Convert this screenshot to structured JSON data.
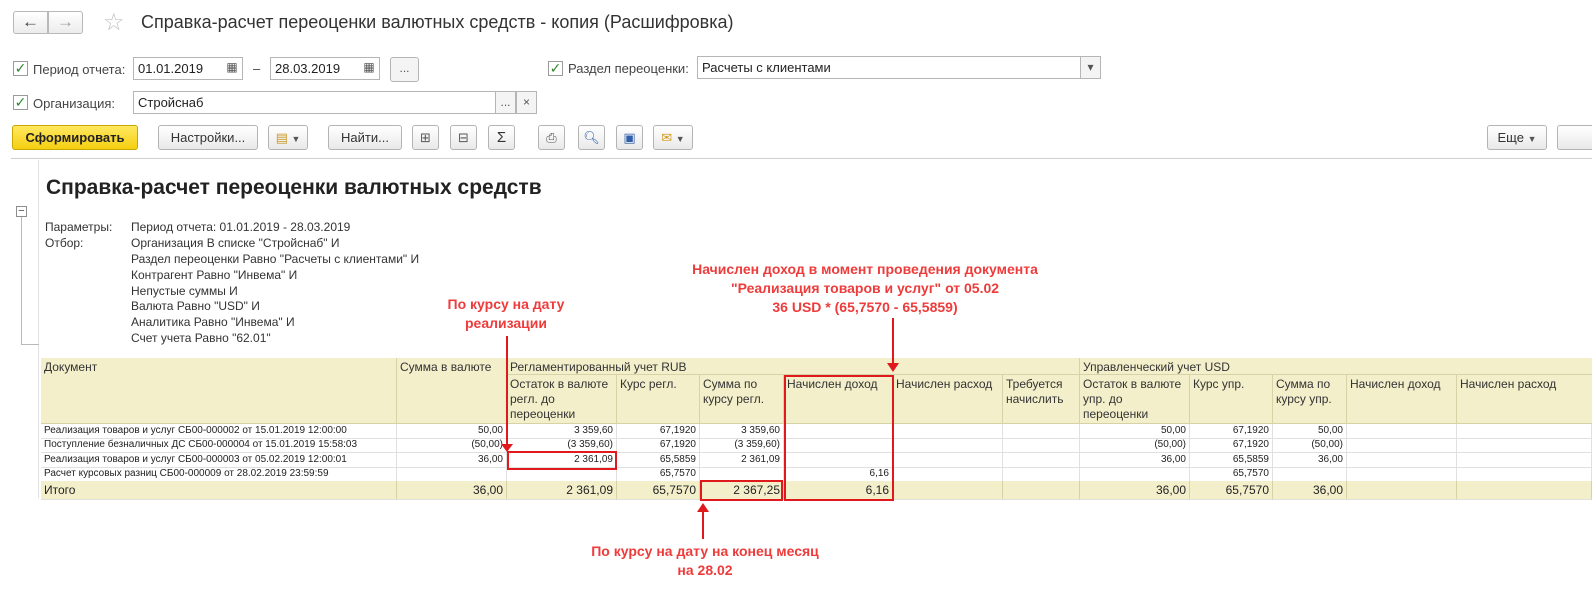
{
  "window": {
    "title": "Справка-расчет переоценки валютных средств - копия (Расшифровка)",
    "back_icon": "←",
    "forward_icon": "→"
  },
  "filters": {
    "period_label": "Период отчета:",
    "date_from": "01.01.2019",
    "date_dash": "–",
    "date_to": "28.03.2019",
    "period_more": "...",
    "section_label": "Раздел переоценки:",
    "section_value": "Расчеты с клиентами",
    "org_label": "Организация:",
    "org_value": "Стройснаб",
    "org_more": "...",
    "org_clear": "×"
  },
  "toolbar": {
    "generate": "Сформировать",
    "settings": "Настройки...",
    "find": "Найти...",
    "sum_icon": "Σ",
    "more": "Еще"
  },
  "report": {
    "title": "Справка-расчет переоценки валютных средств",
    "params_label": "Параметры:",
    "params_value": "Период отчета: 01.01.2019 - 28.03.2019",
    "filter_label": "Отбор:",
    "filter_lines": [
      "Организация В списке \"Стройснаб\" И",
      "Раздел переоценки Равно \"Расчеты с клиентами\" И",
      "Контрагент Равно \"Инвема\" И",
      "Непустые суммы И",
      "Валюта Равно \"USD\" И",
      "Аналитика Равно \"Инвема\" И",
      "Счет учета Равно \"62.01\""
    ]
  },
  "table": {
    "headers": {
      "document": "Документ",
      "amount_currency": "Сумма в валюте",
      "reg_group": "Регламентированный учет RUB",
      "mgmt_group": "Управленческий учет USD",
      "reg_cols": [
        "Остаток в валюте регл. до переоценки",
        "Курс регл.",
        "Сумма по курсу регл.",
        "Начислен доход",
        "Начислен расход",
        "Требуется начислить"
      ],
      "mgmt_cols": [
        "Остаток в валюте упр. до переоценки",
        "Курс упр.",
        "Сумма по курсу упр.",
        "Начислен доход",
        "Начислен расход"
      ]
    },
    "rows": [
      [
        "Реализация товаров и услуг СБ00-000002 от 15.01.2019 12:00:00",
        "50,00",
        "3 359,60",
        "67,1920",
        "3 359,60",
        "",
        "",
        "",
        "50,00",
        "67,1920",
        "50,00",
        "",
        ""
      ],
      [
        "Поступление безналичных ДС СБ00-000004 от 15.01.2019 15:58:03",
        "(50,00)",
        "(3 359,60)",
        "67,1920",
        "(3 359,60)",
        "",
        "",
        "",
        "(50,00)",
        "67,1920",
        "(50,00)",
        "",
        ""
      ],
      [
        "Реализация товаров и услуг СБ00-000003 от 05.02.2019 12:00:01",
        "36,00",
        "2 361,09",
        "65,5859",
        "2 361,09",
        "",
        "",
        "",
        "36,00",
        "65,5859",
        "36,00",
        "",
        ""
      ],
      [
        "Расчет курсовых разниц СБ00-000009 от 28.02.2019 23:59:59",
        "",
        "",
        "65,7570",
        "",
        "6,16",
        "",
        "",
        "",
        "65,7570",
        "",
        "",
        ""
      ]
    ],
    "total": [
      "Итого",
      "36,00",
      "2 361,09",
      "65,7570",
      "2 367,25",
      "6,16",
      "",
      "",
      "36,00",
      "65,7570",
      "36,00",
      "",
      ""
    ]
  },
  "annotations": {
    "sale_rate": "По курсу на дату реализации",
    "income_note_1": "Начислен доход в момент проведения документа",
    "income_note_2": "\"Реализация товаров и услуг\" от 05.02",
    "income_note_3": "36 USD * (65,7570 - 65,5859)",
    "end_rate": "По курсу на дату на конец месяц на 28.02"
  },
  "colors": {
    "header_bg": "#f3efcb",
    "annotation": "#ee3b3b",
    "primary_button": "#f5cf10"
  }
}
